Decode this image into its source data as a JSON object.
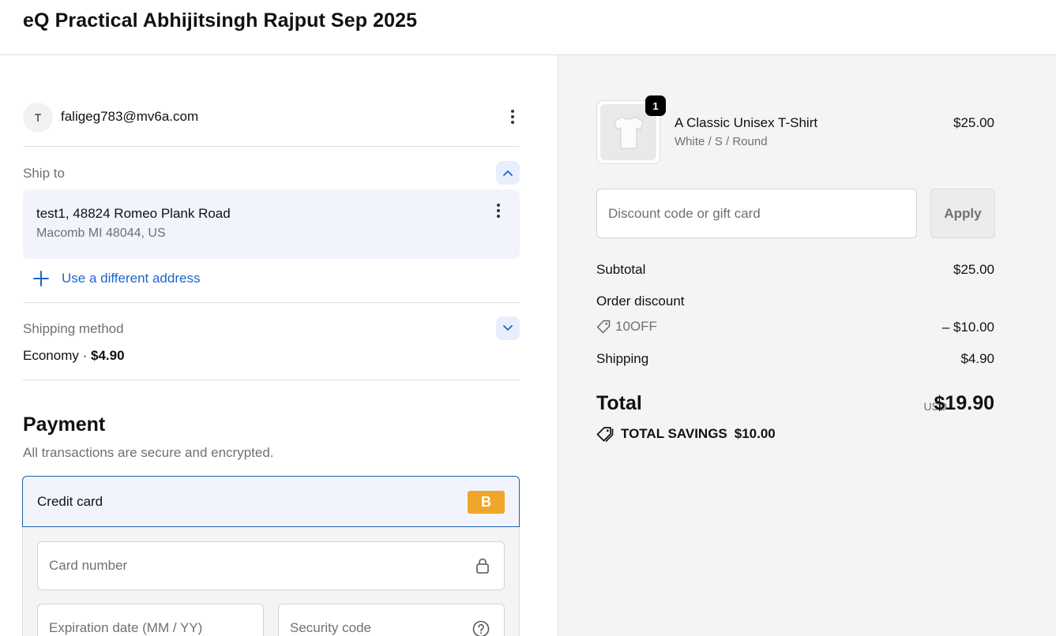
{
  "header": {
    "store_title": "eQ Practical Abhijitsingh Rajput Sep 2025"
  },
  "account": {
    "avatar_initial": "T",
    "email": "faligeg783@mv6a.com"
  },
  "ship_to": {
    "label": "Ship to",
    "address_line1": "test1, 48824 Romeo Plank Road",
    "address_line2": "Macomb MI 48044, US",
    "use_different_label": "Use a different address"
  },
  "shipping_method": {
    "label": "Shipping method",
    "name": "Economy",
    "separator": " · ",
    "price": "$4.90"
  },
  "payment": {
    "title": "Payment",
    "subtitle": "All transactions are secure and encrypted.",
    "credit_card_label": "Credit card",
    "card_badge": "B",
    "card_number_placeholder": "Card number",
    "expiration_placeholder": "Expiration date (MM / YY)",
    "security_code_placeholder": "Security code"
  },
  "order": {
    "product_name": "A Classic Unisex T-Shirt",
    "product_variant": "White / S / Round",
    "product_price": "$25.00",
    "quantity": "1",
    "discount_placeholder": "Discount code or gift card",
    "apply_label": "Apply",
    "subtotal_label": "Subtotal",
    "subtotal_value": "$25.00",
    "order_discount_label": "Order discount",
    "discount_code": "10OFF",
    "discount_value": "– $10.00",
    "shipping_label": "Shipping",
    "shipping_value": "$4.90",
    "total_label": "Total",
    "currency": "USD",
    "total_value": "$19.90",
    "savings_label": "TOTAL SAVINGS",
    "savings_value": "$10.00"
  },
  "colors": {
    "accent": "#1f66c9",
    "card_badge": "#f0a52b",
    "selected_border": "#1f5fa8",
    "summary_bg": "#f4f4f4"
  }
}
